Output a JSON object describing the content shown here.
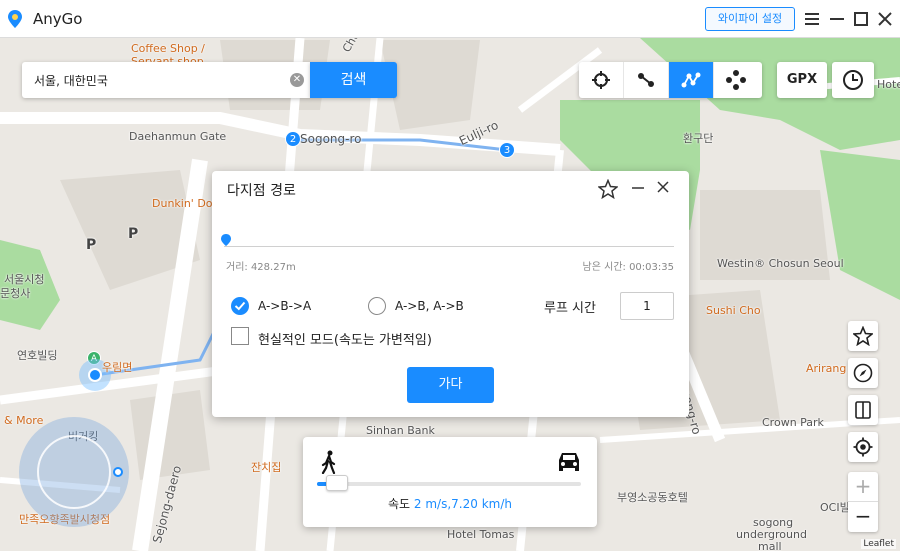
{
  "app": {
    "title": "AnyGo",
    "wifi_button": "와이파이 설정"
  },
  "search": {
    "value": "서울, 대한민국",
    "button": "검색"
  },
  "toolbar": {
    "gpx_label": "GPX"
  },
  "dialog": {
    "title": "다지점 경로",
    "distance": "거리: 428.27m",
    "remaining": "남은 시간: 00:03:35",
    "progress": 0.0,
    "option_a": "A->B->A",
    "option_b": "A->B, A->B",
    "selected_option": "A->B->A",
    "loop_label": "루프 시간",
    "loop_value": "1",
    "realistic_mode": "현실적인 모드(속도는 가변적임)",
    "realistic_checked": false,
    "go_button": "가다"
  },
  "speed": {
    "label": "속도",
    "value": "2 m/s,7.20 km/h",
    "level": 0.05
  },
  "map": {
    "labels": [
      {
        "text": "Coffee Shop /",
        "cls": "orange"
      },
      {
        "text": "Servant shop",
        "cls": "orange"
      },
      {
        "text": "Daehanmun Gate",
        "cls": ""
      },
      {
        "text": "Sogong-ro",
        "cls": ""
      },
      {
        "text": "Eulji-ro",
        "cls": ""
      },
      {
        "text": "환구단",
        "cls": ""
      },
      {
        "text": "Dunkin' Donuts",
        "cls": "orange"
      },
      {
        "text": "P",
        "cls": "big"
      },
      {
        "text": "P",
        "cls": "big"
      },
      {
        "text": "서울시청",
        "cls": ""
      },
      {
        "text": "문청사",
        "cls": ""
      },
      {
        "text": "연호빌딩",
        "cls": ""
      },
      {
        "text": "우림면",
        "cls": "orange"
      },
      {
        "text": "& More",
        "cls": "orange"
      },
      {
        "text": "버거킹",
        "cls": ""
      },
      {
        "text": "만족오향족발시청점",
        "cls": "orange"
      },
      {
        "text": "Sejong-daero",
        "cls": ""
      },
      {
        "text": "잔치집",
        "cls": "orange"
      },
      {
        "text": "Sinhan Bank",
        "cls": ""
      },
      {
        "text": "Hotel Tomas",
        "cls": ""
      },
      {
        "text": "Westin® Chosun Seoul",
        "cls": ""
      },
      {
        "text": "Sushi Cho",
        "cls": "orange"
      },
      {
        "text": "Arirang",
        "cls": "orange"
      },
      {
        "text": "Crown Park",
        "cls": ""
      },
      {
        "text": "부영소공동호텔",
        "cls": ""
      },
      {
        "text": "sogong",
        "cls": ""
      },
      {
        "text": "underground",
        "cls": ""
      },
      {
        "text": "mall",
        "cls": ""
      },
      {
        "text": "OCI빌",
        "cls": ""
      },
      {
        "text": "Hote",
        "cls": ""
      },
      {
        "text": "Sogong-ro",
        "cls": ""
      },
      {
        "text": "Chu",
        "cls": ""
      }
    ],
    "route_markers": [
      "2",
      "3"
    ],
    "start_marker": "A",
    "attribution": "Leaflet"
  },
  "colors": {
    "accent": "#1a8cff",
    "park": "#aadca0",
    "road": "#ffffff"
  }
}
